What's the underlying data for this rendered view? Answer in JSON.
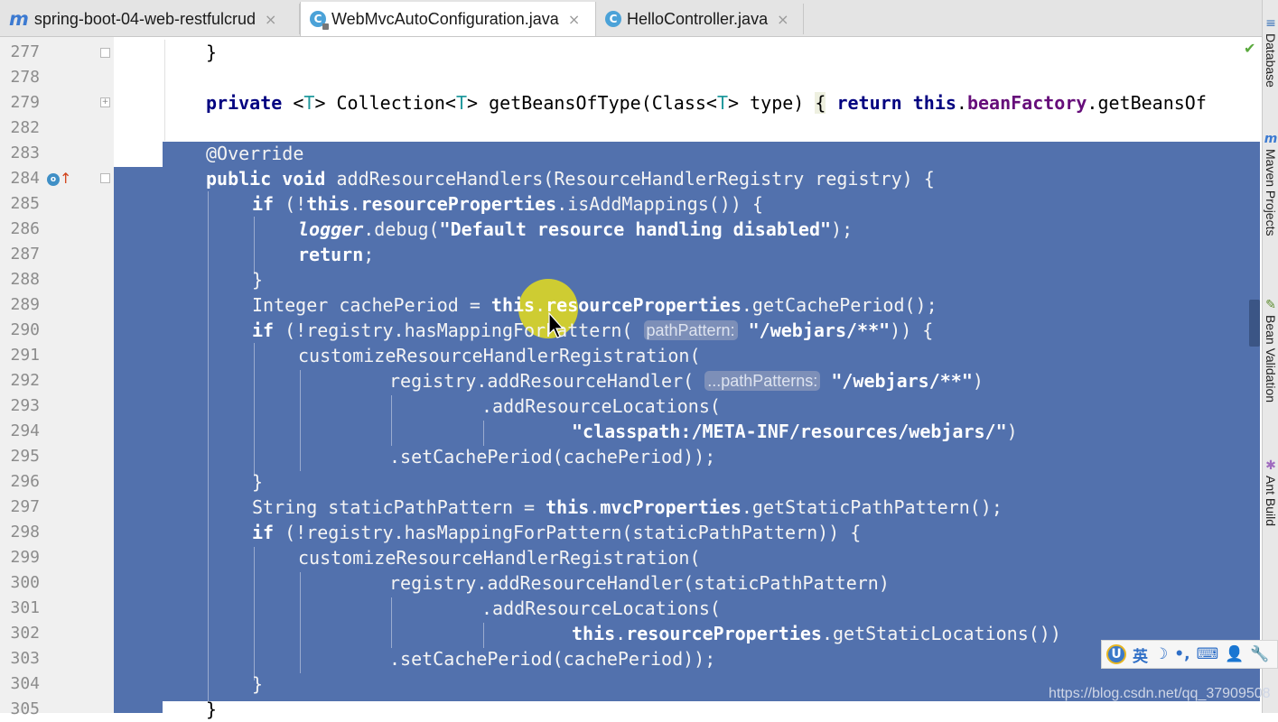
{
  "tabs": [
    {
      "icon": "maven-module-icon",
      "label": "spring-boot-04-web-restfulcrud",
      "close": "×",
      "active": false
    },
    {
      "icon": "class-icon",
      "label": "WebMvcAutoConfiguration.java",
      "close": "×",
      "active": true
    },
    {
      "icon": "class-icon",
      "label": "HelloController.java",
      "close": "×",
      "active": false
    }
  ],
  "sidebar": {
    "database": "Database",
    "maven": "Maven Projects",
    "bean_validation": "Bean Validation",
    "ant_build": "Ant Build"
  },
  "editor": {
    "selected_lines": "283-304",
    "lines": [
      {
        "n": "277",
        "text": "}"
      },
      {
        "n": "278",
        "text": ""
      },
      {
        "n": "279",
        "text": "private <T> Collection<T> getBeansOfType(Class<T> type) { return this.beanFactory.getBeansOf"
      },
      {
        "n": "282",
        "text": ""
      },
      {
        "n": "283",
        "text": "@Override"
      },
      {
        "n": "284",
        "text": "public void addResourceHandlers(ResourceHandlerRegistry registry) {"
      },
      {
        "n": "285",
        "text": "if (!this.resourceProperties.isAddMappings()) {"
      },
      {
        "n": "286",
        "text": "logger.debug(\"Default resource handling disabled\");"
      },
      {
        "n": "287",
        "text": "return;"
      },
      {
        "n": "288",
        "text": "}"
      },
      {
        "n": "289",
        "text": "Integer cachePeriod = this.resourceProperties.getCachePeriod();"
      },
      {
        "n": "290",
        "text": "if (!registry.hasMappingForPattern( pathPattern: \"/webjars/**\")) {"
      },
      {
        "n": "291",
        "text": "customizeResourceHandlerRegistration("
      },
      {
        "n": "292",
        "text": "registry.addResourceHandler( ...pathPatterns: \"/webjars/**\")"
      },
      {
        "n": "293",
        "text": ".addResourceLocations("
      },
      {
        "n": "294",
        "text": "\"classpath:/META-INF/resources/webjars/\")"
      },
      {
        "n": "295",
        "text": ".setCachePeriod(cachePeriod));"
      },
      {
        "n": "296",
        "text": "}"
      },
      {
        "n": "297",
        "text": "String staticPathPattern = this.mvcProperties.getStaticPathPattern();"
      },
      {
        "n": "298",
        "text": "if (!registry.hasMappingForPattern(staticPathPattern)) {"
      },
      {
        "n": "299",
        "text": "customizeResourceHandlerRegistration("
      },
      {
        "n": "300",
        "text": "registry.addResourceHandler(staticPathPattern)"
      },
      {
        "n": "301",
        "text": ".addResourceLocations("
      },
      {
        "n": "302",
        "text": "this.resourceProperties.getStaticLocations())"
      },
      {
        "n": "303",
        "text": ".setCachePeriod(cachePeriod));"
      },
      {
        "n": "304",
        "text": "}"
      },
      {
        "n": "305",
        "text": "}"
      }
    ],
    "hints": {
      "path_pattern": "pathPattern:",
      "path_patterns": "...pathPatterns:"
    }
  },
  "ime_toolbar": {
    "lang": "英",
    "moon": "☽",
    "punct": "•,",
    "keyboard": "⌨",
    "user": "👤",
    "tools": "🔧"
  },
  "watermark": "https://blog.csdn.net/qq_37909508",
  "colors": {
    "selection": "#5271ad",
    "keyword": "#000080",
    "field": "#660e7a",
    "string": "#008000",
    "cursor_highlight": "#e4dc1c"
  }
}
